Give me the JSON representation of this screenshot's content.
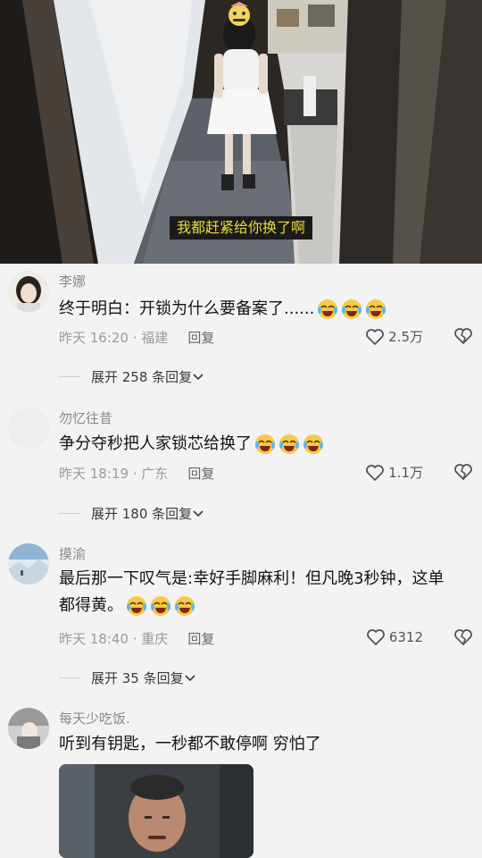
{
  "video": {
    "subtitle": "我都赶紧给你换了啊"
  },
  "comments": [
    {
      "user": "李娜",
      "text": "终于明白：开锁为什么要备案了......",
      "time": "昨天 16:20 · 福建",
      "reply": "回复",
      "likes": "2.5万",
      "expand": "展开 258 条回复"
    },
    {
      "user": "勿忆往昔",
      "text": "争分夺秒把人家锁芯给换了",
      "time": "昨天 18:19 · 广东",
      "reply": "回复",
      "likes": "1.1万",
      "expand": "展开 180 条回复"
    },
    {
      "user": "摸渝",
      "text_line1": "最后那一下叹气是:幸好手脚麻利！但凡晚3秒钟，这单",
      "text_line2": "都得黄。",
      "time": "昨天 18:40 · 重庆",
      "reply": "回复",
      "likes": "6312",
      "expand": "展开 35 条回复"
    },
    {
      "user": "每天少吃饭.",
      "text": "听到有钥匙，一秒都不敢停啊 穷怕了"
    }
  ],
  "icons": {
    "like": "heart-outline-icon",
    "dislike": "broken-heart-icon",
    "expand": "chevron-down-icon",
    "emoji": "crying-laughing-emoji"
  }
}
